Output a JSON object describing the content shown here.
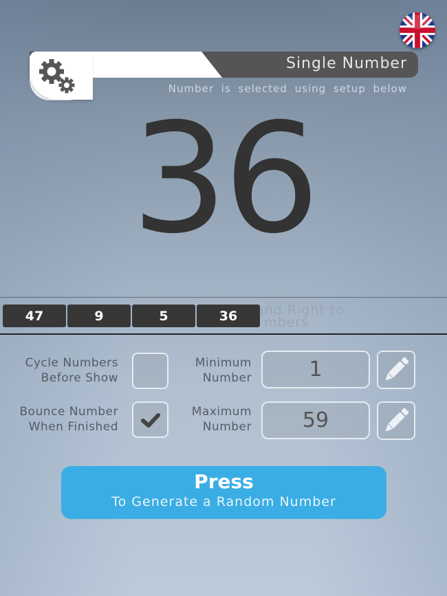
{
  "language": {
    "icon": "uk-flag-icon",
    "label": "English"
  },
  "header": {
    "settings_icon": "gears-icon",
    "mode_title": "Single Number",
    "mode_subtitle": "Number is selected using setup below"
  },
  "result": {
    "current_number": "36"
  },
  "history": {
    "numbers": [
      "47",
      "9",
      "5",
      "36"
    ],
    "hint_text_line1": "and Right to",
    "hint_text_line2": "mbers"
  },
  "options": {
    "cycle_numbers": {
      "label_line1": "Cycle Numbers",
      "label_line2": "Before Show",
      "checked": false
    },
    "bounce_number": {
      "label_line1": "Bounce Number",
      "label_line2": "When Finished",
      "checked": true
    },
    "minimum": {
      "label_line1": "Minimum",
      "label_line2": "Number",
      "value": "1",
      "edit_icon": "pencil-icon"
    },
    "maximum": {
      "label_line1": "Maximum",
      "label_line2": "Number",
      "value": "59",
      "edit_icon": "pencil-icon"
    }
  },
  "generate_button": {
    "title": "Press",
    "subtitle": "To Generate a Random Number",
    "color": "#3aade4"
  }
}
